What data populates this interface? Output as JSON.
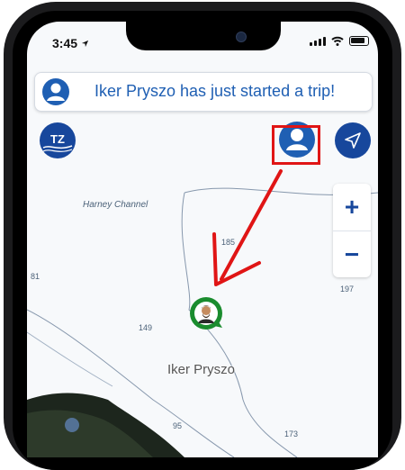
{
  "status_bar": {
    "time": "3:45"
  },
  "notification": {
    "text": "Iker Pryszo has just started a trip!"
  },
  "map_controls": {
    "timezone_label": "TZ",
    "zoom_in_label": "+",
    "zoom_out_label": "−"
  },
  "map": {
    "place_label": "Harney Channel",
    "user_name": "Iker Pryszo",
    "depths": [
      "185",
      "197",
      "149",
      "95",
      "173",
      "81"
    ]
  },
  "colors": {
    "brand_blue": "#17479c",
    "banner_text": "#1f5fb3",
    "highlight_red": "#e01515",
    "marker_green": "#1a8c2e"
  },
  "icons": [
    "location-arrow-icon",
    "signal-icon",
    "wifi-icon",
    "battery-icon",
    "user-icon",
    "navigation-icon"
  ]
}
